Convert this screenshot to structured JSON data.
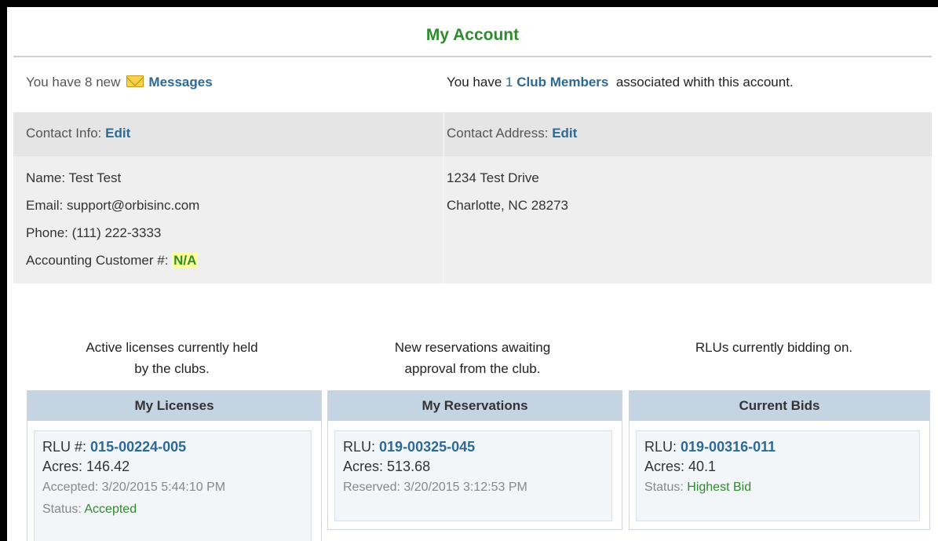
{
  "title": "My Account",
  "messages": {
    "prefix": "You have",
    "count": "8",
    "suffix": "new",
    "link": "Messages"
  },
  "club": {
    "prefix": "You have",
    "count": "1",
    "link": "Club Members",
    "suffix": "associated whith this account."
  },
  "contact_info": {
    "label": "Contact Info:",
    "edit": "Edit",
    "name_label": "Name:",
    "name": "Test Test",
    "email_label": "Email:",
    "email": "support@orbisinc.com",
    "phone_label": "Phone:",
    "phone": "(111) 222-3333",
    "acct_label": "Accounting Customer #:",
    "acct": "N/A"
  },
  "contact_address": {
    "label": "Contact Address:",
    "edit": "Edit",
    "line1": "1234 Test Drive",
    "line2": "Charlotte, NC 28273"
  },
  "licenses": {
    "caption1": "Active licenses currently held",
    "caption2": "by the clubs.",
    "header": "My Licenses",
    "rlu_label": "RLU #:",
    "rlu": "015-00224-005",
    "acres_label": "Acres:",
    "acres": "146.42",
    "date_label": "Accepted:",
    "date": "3/20/2015 5:44:10 PM",
    "status_label": "Status:",
    "status": "Accepted"
  },
  "reservations": {
    "caption1": "New reservations awaiting",
    "caption2": "approval from the club.",
    "header": "My Reservations",
    "rlu_label": "RLU:",
    "rlu": "019-00325-045",
    "acres_label": "Acres:",
    "acres": "513.68",
    "date_label": "Reserved:",
    "date": "3/20/2015 3:12:53 PM"
  },
  "bids": {
    "caption1": "RLUs currently bidding on.",
    "header": "Current Bids",
    "rlu_label": "RLU:",
    "rlu": "019-00316-011",
    "acres_label": "Acres:",
    "acres": "40.1",
    "status_label": "Status:",
    "status": "Highest Bid"
  },
  "colors": {
    "accent_green": "#2e8b2e",
    "link_blue": "#2c6a94",
    "panel_header": "#c5d4e3"
  },
  "icons": {
    "messages": "envelope-icon"
  }
}
